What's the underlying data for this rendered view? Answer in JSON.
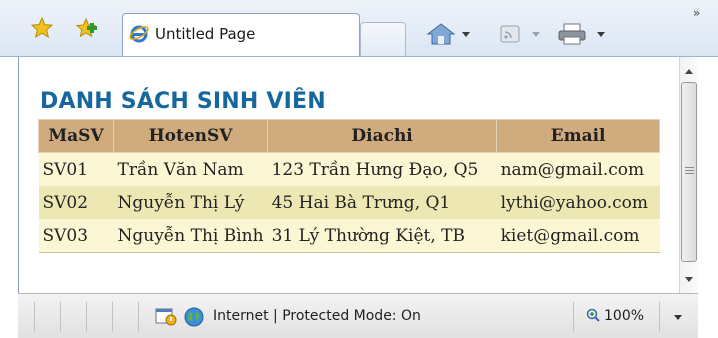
{
  "toolbar": {
    "tab_title": "Untitled Page",
    "icons": [
      "favorites-star-icon",
      "add-favorites-icon",
      "ie-logo-icon",
      "home-icon",
      "feeds-icon",
      "print-icon",
      "chevron-right-icon"
    ],
    "overflow_glyph": "»"
  },
  "page": {
    "heading": "DANH SÁCH SINH VIÊN",
    "table": {
      "headers": [
        "MaSV",
        "HotenSV",
        "Diachi",
        "Email"
      ],
      "rows": [
        [
          "SV01",
          "Trần Văn Nam",
          "123 Trần Hưng Đạo, Q5",
          "nam@gmail.com"
        ],
        [
          "SV02",
          "Nguyễn Thị Lý",
          "45 Hai Bà Trưng, Q1",
          "lythi@yahoo.com"
        ],
        [
          "SV03",
          "Nguyễn Thị Bình",
          "31 Lý Thường Kiệt, TB",
          "kiet@gmail.com"
        ]
      ]
    }
  },
  "status": {
    "zone_text": "Internet | Protected Mode: On",
    "zoom": "100%"
  },
  "colors": {
    "heading": "#17679f",
    "header_bg": "#d0ab7e",
    "row_odd": "#fbf6d3",
    "row_even": "#ede8b3"
  }
}
